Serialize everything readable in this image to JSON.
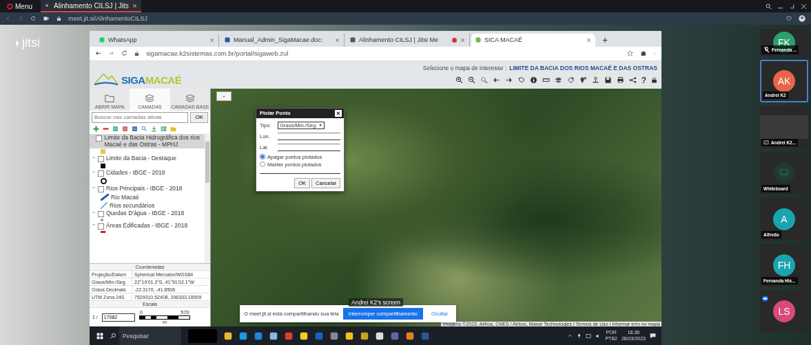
{
  "outer_browser": {
    "menu": "Menu",
    "tab": {
      "title": "Alinhamento CILSJ | Jits",
      "selected": true
    },
    "url": "meet.jit.si/AlinhamentoCILSJ"
  },
  "jitsi_logo": "jitsi",
  "shared_browser": {
    "tabs": [
      {
        "title": "WhatsApp",
        "selected": false,
        "recording": false
      },
      {
        "title": "Manual_Admin_SigaMacae.doc:",
        "selected": false,
        "recording": false
      },
      {
        "title": "Alinhamento CILSJ | Jitsi Me",
        "selected": false,
        "recording": true
      },
      {
        "title": "SICA MACAÉ",
        "selected": true,
        "recording": false
      }
    ],
    "new_tab": "+",
    "url": "sigamacae.k2sistemas.com.br/portal/sigaweb.zul"
  },
  "app": {
    "logo": [
      "SIGA",
      "MACAÉ"
    ],
    "map_select": {
      "label": "Selecione o mapa de interesse :",
      "value": "LIMITE DA BACIA DOS RIOS MACAÉ E DAS OSTRAS"
    },
    "help_button": "?",
    "panel_tabs": [
      {
        "label": "ABRIR MAPA",
        "selected": false
      },
      {
        "label": "CAMADAS",
        "selected": true
      },
      {
        "label": "CAMADAS BASE",
        "selected": false
      }
    ],
    "search": {
      "placeholder": "Buscar nas camadas ativas",
      "button": "OK"
    },
    "layers": [
      {
        "name": "Limite da Bacia Hidrográfica dos rios Macaé e das Ostras - MPHJ",
        "selected": true,
        "checked": false,
        "legend": [
          {
            "kind": "square",
            "color": "#e8c84a"
          }
        ]
      },
      {
        "name": "Limite da Bacia - Destaque",
        "selected": false,
        "checked": false,
        "legend": [
          {
            "kind": "square",
            "color": "#111111"
          }
        ]
      },
      {
        "name": "Cidades - IBGE - 2018",
        "selected": false,
        "checked": false,
        "legend": [
          {
            "kind": "circle",
            "color": "#111111"
          }
        ]
      },
      {
        "name": "Rios Principais - IBGE - 2018",
        "selected": false,
        "checked": false,
        "legend": [
          {
            "kind": "line",
            "color": "#2a5db0",
            "label": "Rio Macaé"
          },
          {
            "kind": "thin-line",
            "color": "#8ab0d8",
            "label": "Rios secundários"
          }
        ]
      },
      {
        "name": "Quedas D'água - IBGE - 2018",
        "selected": false,
        "checked": false,
        "legend": [
          {
            "kind": "dot",
            "color": "#7aa0d0"
          }
        ]
      },
      {
        "name": "Áreas Edificadas - IBGE - 2018",
        "selected": false,
        "checked": false,
        "legend": [
          {
            "kind": "bar",
            "color": "#d02020"
          }
        ]
      }
    ],
    "coordinates": {
      "title": "Coordenadas",
      "rows": [
        {
          "label": "Projeção/Datum",
          "value": "Spherical Mercator/WGS84"
        },
        {
          "label": "Graus/Min./Seg.",
          "value": "22°19'01.2\"S, 41°51'02.1\"W"
        },
        {
          "label": "Graus Decimais",
          "value": "-22.3170, -41.8506"
        },
        {
          "label": "UTM Zona 24S",
          "value": "7529310.52408, 206333.18509"
        }
      ]
    },
    "scale": {
      "title": "Escala",
      "prefix": "1 /",
      "value": "17082",
      "bar_labels": [
        "0",
        "570"
      ],
      "unit": "m"
    },
    "map": {
      "collapse_button": "-",
      "attribution": "Imagens ©2023, Airbus, CNES / Airbus, Maxar Technologies | Termos de Uso | Informar erro no mapa"
    },
    "dialog": {
      "title": "Plotar Ponto",
      "close": "×",
      "type_label": "Tipo:",
      "type_value": "Graus/Min./Seg.",
      "lon_label": "Lon.",
      "lat_label": "Lat.",
      "options": [
        {
          "label": "Apagar pontos plotados",
          "selected": true
        },
        {
          "label": "Manter pontos plotados",
          "selected": false
        }
      ],
      "ok": "OK",
      "cancel": "Cancelar"
    }
  },
  "share_notice": {
    "text": "O meet.jit.si está compartilhando sua tela",
    "stop_button": "Interromper compartilhamento",
    "hide_button": "Ocultar"
  },
  "screen_label": "Andrei K2's screen",
  "taskbar": {
    "search_placeholder": "Pesquisar",
    "language": "POR",
    "layout": "PTB2",
    "time": "16:36",
    "date": "28/03/2023"
  },
  "participants": [
    {
      "kind": "avatar",
      "name": "Fernanda ...",
      "initials": "FK",
      "color": "#2e9e6a",
      "selected": false,
      "muted": true
    },
    {
      "kind": "avatar",
      "name": "Andrei K2",
      "initials": "AK",
      "color": "#e8644a",
      "selected": true,
      "muted": false
    },
    {
      "kind": "screen",
      "name": "Andrei K2...",
      "selected": false,
      "muted": false
    },
    {
      "kind": "whiteboard",
      "name": "Whiteboard",
      "selected": false,
      "muted": false
    },
    {
      "kind": "avatar",
      "name": "Alfredo",
      "initials": "A",
      "color": "#1aa3b0",
      "selected": false,
      "muted": false
    },
    {
      "kind": "avatar",
      "name": "Fernanda His...",
      "initials": "FH",
      "color": "#1aa3b0",
      "selected": false,
      "muted": false
    },
    {
      "kind": "avatar",
      "initials": "LS",
      "color": "#d84a78",
      "selected": false,
      "muted": false
    }
  ]
}
